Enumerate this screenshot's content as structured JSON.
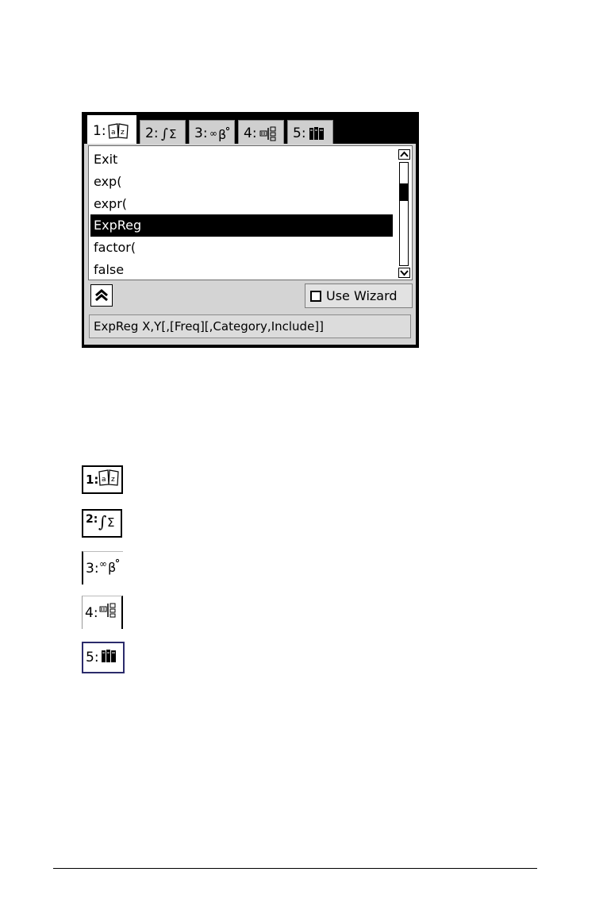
{
  "catalog": {
    "tabs": [
      {
        "number": "1:",
        "icon": "book-az-icon",
        "active": true
      },
      {
        "number": "2:",
        "icon": "integral-sigma-icon",
        "active": false
      },
      {
        "number": "3:",
        "icon": "infinity-beta-icon",
        "active": false
      },
      {
        "number": "4:",
        "icon": "units-icon",
        "active": false
      },
      {
        "number": "5:",
        "icon": "library-books-icon",
        "active": false
      }
    ],
    "list_items": [
      "Exit",
      "exp(",
      "expr(",
      "ExpReg",
      "factor(",
      "false"
    ],
    "selected_item": "ExpReg",
    "collapse_icon": "double-chevron-up-icon",
    "wizard_label": "Use Wizard",
    "wizard_checked": false,
    "syntax_help": "ExpReg X,Y[,[Freq][,Category,Include]]"
  },
  "legend_icons": [
    {
      "number": "1:",
      "icon": "book-az-icon"
    },
    {
      "number": "2:",
      "icon": "integral-sigma-icon"
    },
    {
      "number": "3:",
      "icon": "infinity-beta-icon"
    },
    {
      "number": "4:",
      "icon": "units-icon"
    },
    {
      "number": "5:",
      "icon": "library-books-icon"
    }
  ]
}
